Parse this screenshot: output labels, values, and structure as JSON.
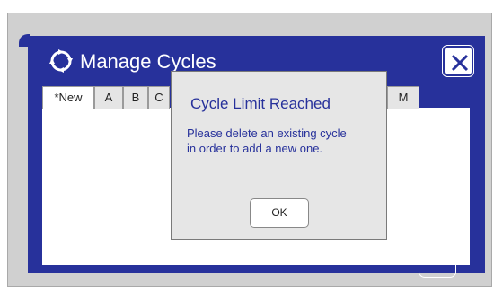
{
  "window": {
    "title": "Manage Cycles"
  },
  "tabs": [
    "*New",
    "A",
    "B",
    "C",
    "M"
  ],
  "dialog": {
    "title": "Cycle Limit Reached",
    "message": "Please delete an existing cycle\nin order to add a new one.",
    "ok_label": "OK"
  },
  "colors": {
    "accent": "#27319b",
    "device_bg": "#d0d0d0",
    "dialog_bg": "#e6e6e6"
  },
  "icons": {
    "title": "cycle-arrows-icon",
    "close": "close-icon"
  }
}
